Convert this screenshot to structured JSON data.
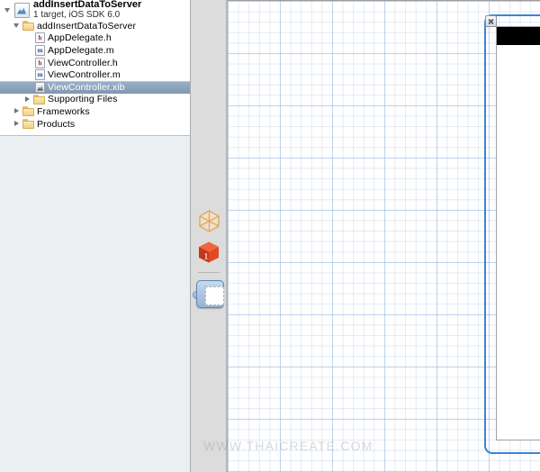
{
  "window": {
    "title": "addInsertDataToServer"
  },
  "navigator": {
    "project": {
      "name": "addInsertDataToServer",
      "subtitle": "1 target, iOS SDK 6.0",
      "icon": "xcode-project-icon",
      "expanded": true
    },
    "tree": [
      {
        "label": "addInsertDataToServer",
        "icon": "folder-icon",
        "kind": "group",
        "depth": 1,
        "expanded": true,
        "selected": false
      },
      {
        "label": "AppDelegate.h",
        "icon": "header-file-icon",
        "kind": "h",
        "depth": 2,
        "expanded": null,
        "selected": false
      },
      {
        "label": "AppDelegate.m",
        "icon": "implementation-file-icon",
        "kind": "m",
        "depth": 2,
        "expanded": null,
        "selected": false
      },
      {
        "label": "ViewController.h",
        "icon": "header-file-icon",
        "kind": "h",
        "depth": 2,
        "expanded": null,
        "selected": false
      },
      {
        "label": "ViewController.m",
        "icon": "implementation-file-icon",
        "kind": "m",
        "depth": 2,
        "expanded": null,
        "selected": false
      },
      {
        "label": "ViewController.xib",
        "icon": "interface-builder-file-icon",
        "kind": "xib",
        "depth": 2,
        "expanded": null,
        "selected": true
      },
      {
        "label": "Supporting Files",
        "icon": "folder-icon",
        "kind": "group",
        "depth": 2,
        "expanded": false,
        "selected": false
      },
      {
        "label": "Frameworks",
        "icon": "folder-icon",
        "kind": "group",
        "depth": 1,
        "expanded": false,
        "selected": false
      },
      {
        "label": "Products",
        "icon": "folder-icon",
        "kind": "group",
        "depth": 1,
        "expanded": false,
        "selected": false
      }
    ]
  },
  "object_strip": {
    "items": [
      {
        "name": "placeholders-wireframe-cube",
        "icon": "wireframe-cube-icon",
        "selected": false
      },
      {
        "name": "file-owner-solid-cube",
        "icon": "solid-cube-icon",
        "badge": "1",
        "selected": false
      },
      {
        "name": "view-object",
        "icon": "view-placeholder-icon",
        "selected": true
      }
    ]
  },
  "canvas": {
    "device": {
      "status_bar": {
        "battery_icon": "battery-icon"
      },
      "background_color": "#ffffff"
    },
    "selection": {
      "color": "#3a84d6",
      "close_badge_icon": "close-x-icon"
    },
    "grid": {
      "enabled": true,
      "minor_color": "#a0bee1",
      "major_color": "#a0bee1"
    }
  },
  "watermark": {
    "text": "WWW.THAICREATE.COM"
  }
}
